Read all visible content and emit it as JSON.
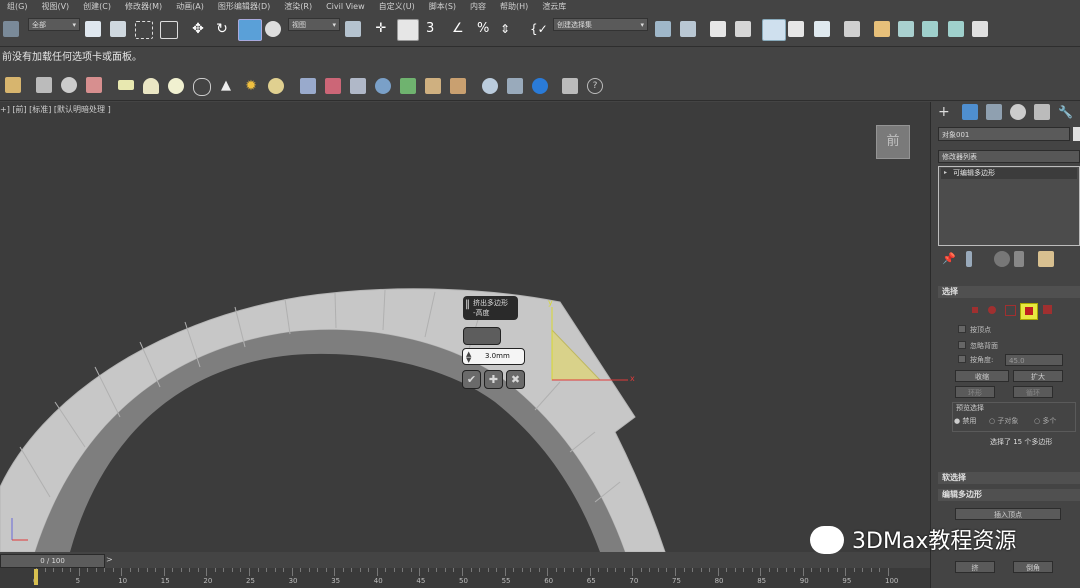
{
  "menu": [
    "组(G)",
    "视图(V)",
    "创建(C)",
    "修改器(M)",
    "动画(A)",
    "图形编辑器(D)",
    "渲染(R)",
    "Civil View",
    "自定义(U)",
    "脚本(S)",
    "内容",
    "帮助(H)",
    "渲云库"
  ],
  "toolbar": {
    "selection_filter": "全部",
    "ref_coord": "视图",
    "named_selection": "创建选择集"
  },
  "notice": "前没有加载任何选项卡或面板。",
  "viewport": {
    "label": "+] [前] [标准] [默认明暗处理 ]",
    "viewcube": "前",
    "gizmo_x": "x",
    "gizmo_y": "y"
  },
  "caddy": {
    "title_line1": "挤出多边形",
    "title_line2": "-高度",
    "value": "3.0mm",
    "ok_icon": "✔",
    "apply_icon": "✚",
    "cancel_icon": "✖"
  },
  "timeline": {
    "frame": "0 / 100",
    "ticks": [
      "0",
      "5",
      "10",
      "15",
      "20",
      "25",
      "30",
      "35",
      "40",
      "45",
      "50",
      "55",
      "60",
      "65",
      "70",
      "75",
      "80",
      "85",
      "90",
      "95",
      "100"
    ]
  },
  "panel": {
    "object_name": "对象001",
    "modifier_list": "修改器列表",
    "stack_item": "可编辑多边形",
    "rollout_select": "选择",
    "by_vertex": "按顶点",
    "ignore_backface": "忽略背面",
    "by_angle": "按角度:",
    "angle_value": "45.0",
    "shrink": "收缩",
    "grow": "扩大",
    "ring": "环形",
    "loop": "循环",
    "preview_label": "预览选择",
    "disabled": "禁用",
    "subobject": "子对象",
    "multi": "多个",
    "selection_info": "选择了 15 个多边形",
    "rollout_soft": "软选择",
    "rollout_edit_poly": "编辑多边形",
    "insert_vertex": "插入顶点",
    "extrude": "挤",
    "bevel": "倒角"
  },
  "watermark": "3DMax教程资源",
  "colors": {
    "ring_light": "#c9c9c9",
    "ring_dark": "#8f8f8f",
    "selected_face": "#d9d28a",
    "gizmo_x": "#e03a3a",
    "gizmo_y": "#d8d830"
  }
}
